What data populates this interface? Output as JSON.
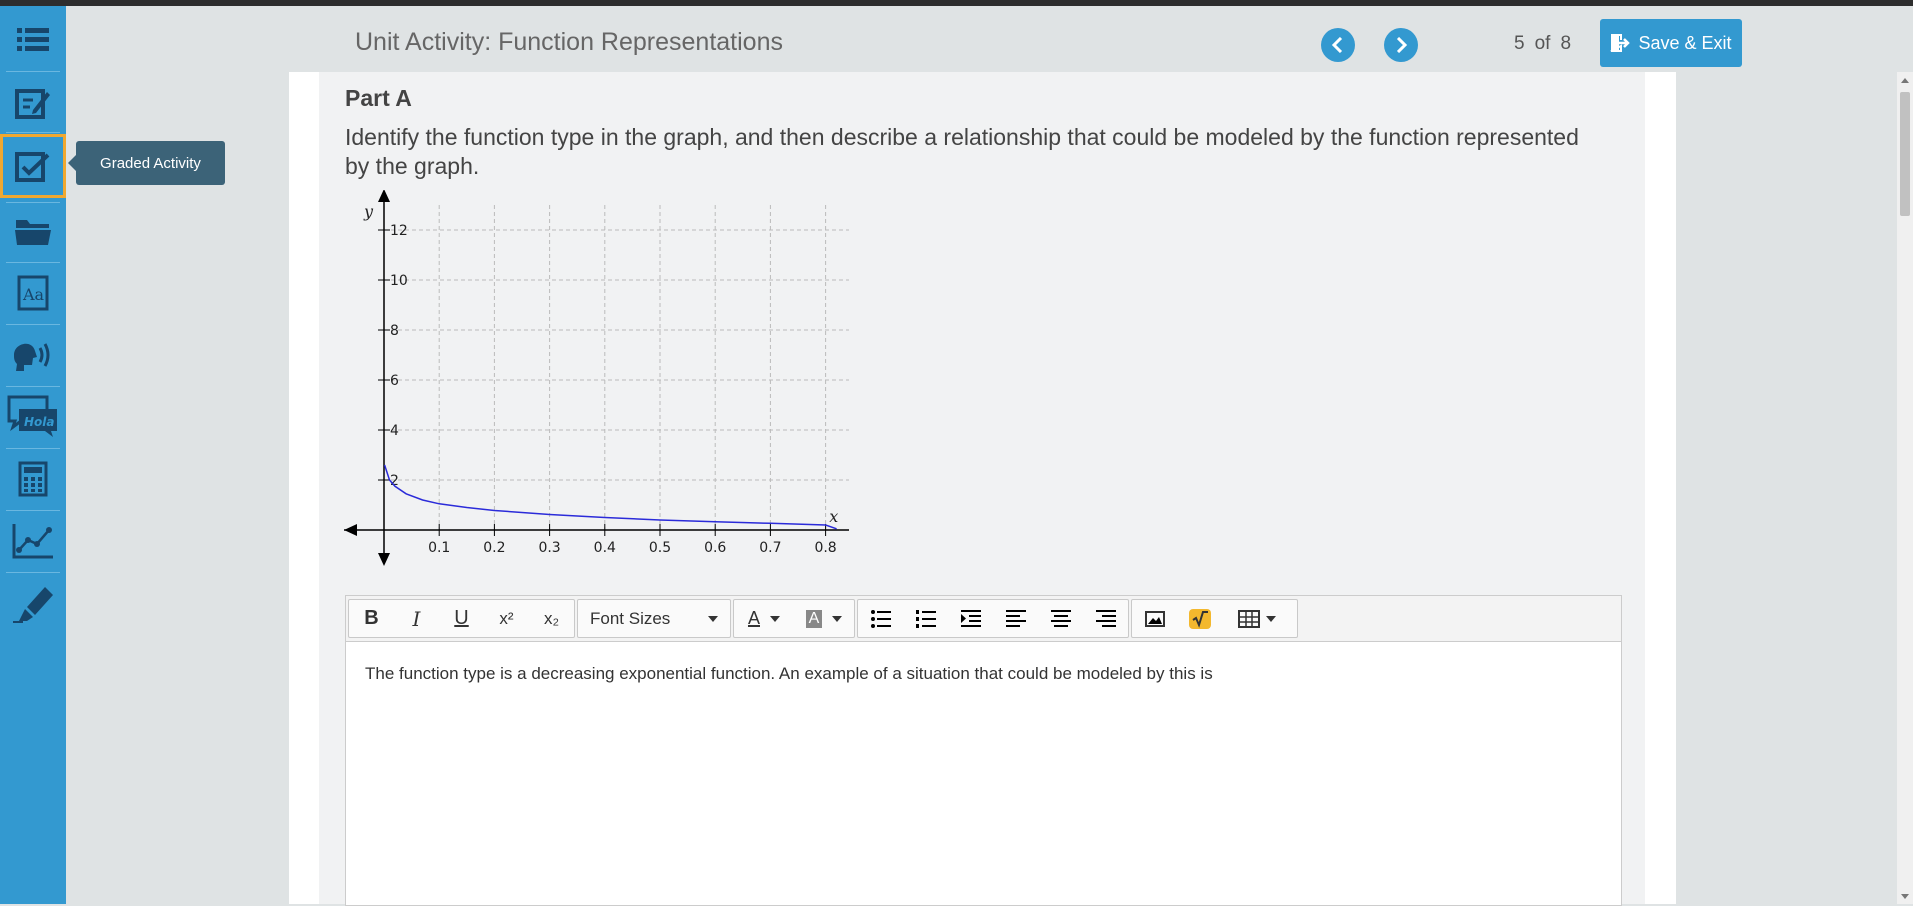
{
  "header": {
    "title": "Unit Activity: Function Representations",
    "page_current": "5",
    "page_of": "of",
    "page_total": "8",
    "save_exit_label": "Save & Exit"
  },
  "sidebar": {
    "icons": [
      "list-icon",
      "notepad-icon",
      "graded-activity-icon",
      "folder-icon",
      "dictionary-icon",
      "text-to-speech-icon",
      "translation-icon",
      "calculator-icon",
      "graph-icon",
      "highlighter-icon"
    ],
    "tooltip": "Graded Activity",
    "translation_badge": "Hola"
  },
  "question": {
    "part_title": "Part A",
    "text": "Identify the function type in the graph, and then describe a relationship that could be modeled by the function represented by the graph."
  },
  "chart_data": {
    "type": "line",
    "xlabel": "x",
    "ylabel": "y",
    "x_ticks": [
      "0.1",
      "0.2",
      "0.3",
      "0.4",
      "0.5",
      "0.6",
      "0.7",
      "0.8"
    ],
    "y_ticks": [
      "2",
      "4",
      "6",
      "8",
      "10",
      "12"
    ],
    "xlim": [
      0,
      0.85
    ],
    "ylim": [
      0,
      13
    ],
    "grid": true,
    "series": [
      {
        "color": "#2b2bd9",
        "x": [
          0.001,
          0.01,
          0.02,
          0.04,
          0.07,
          0.1,
          0.15,
          0.2,
          0.3,
          0.4,
          0.5,
          0.6,
          0.7,
          0.8,
          0.82
        ],
        "y": [
          2.6,
          2.0,
          1.75,
          1.45,
          1.2,
          1.05,
          0.9,
          0.78,
          0.62,
          0.5,
          0.4,
          0.33,
          0.27,
          0.2,
          0.05
        ]
      }
    ]
  },
  "toolbar": {
    "bold": "B",
    "italic": "I",
    "underline": "U",
    "superscript": "x²",
    "subscript": "x₂",
    "font_sizes": "Font Sizes",
    "font_color": "A",
    "highlight_color": "A"
  },
  "editor": {
    "text": "The function type is a decreasing exponential function. An example of a situation that could be modeled by this is"
  },
  "colors": {
    "sidebar": "#3399d0",
    "accent": "#3399d0",
    "active_outline": "#f0a830",
    "tooltip": "#3c6378",
    "curve": "#2b2bd9"
  }
}
